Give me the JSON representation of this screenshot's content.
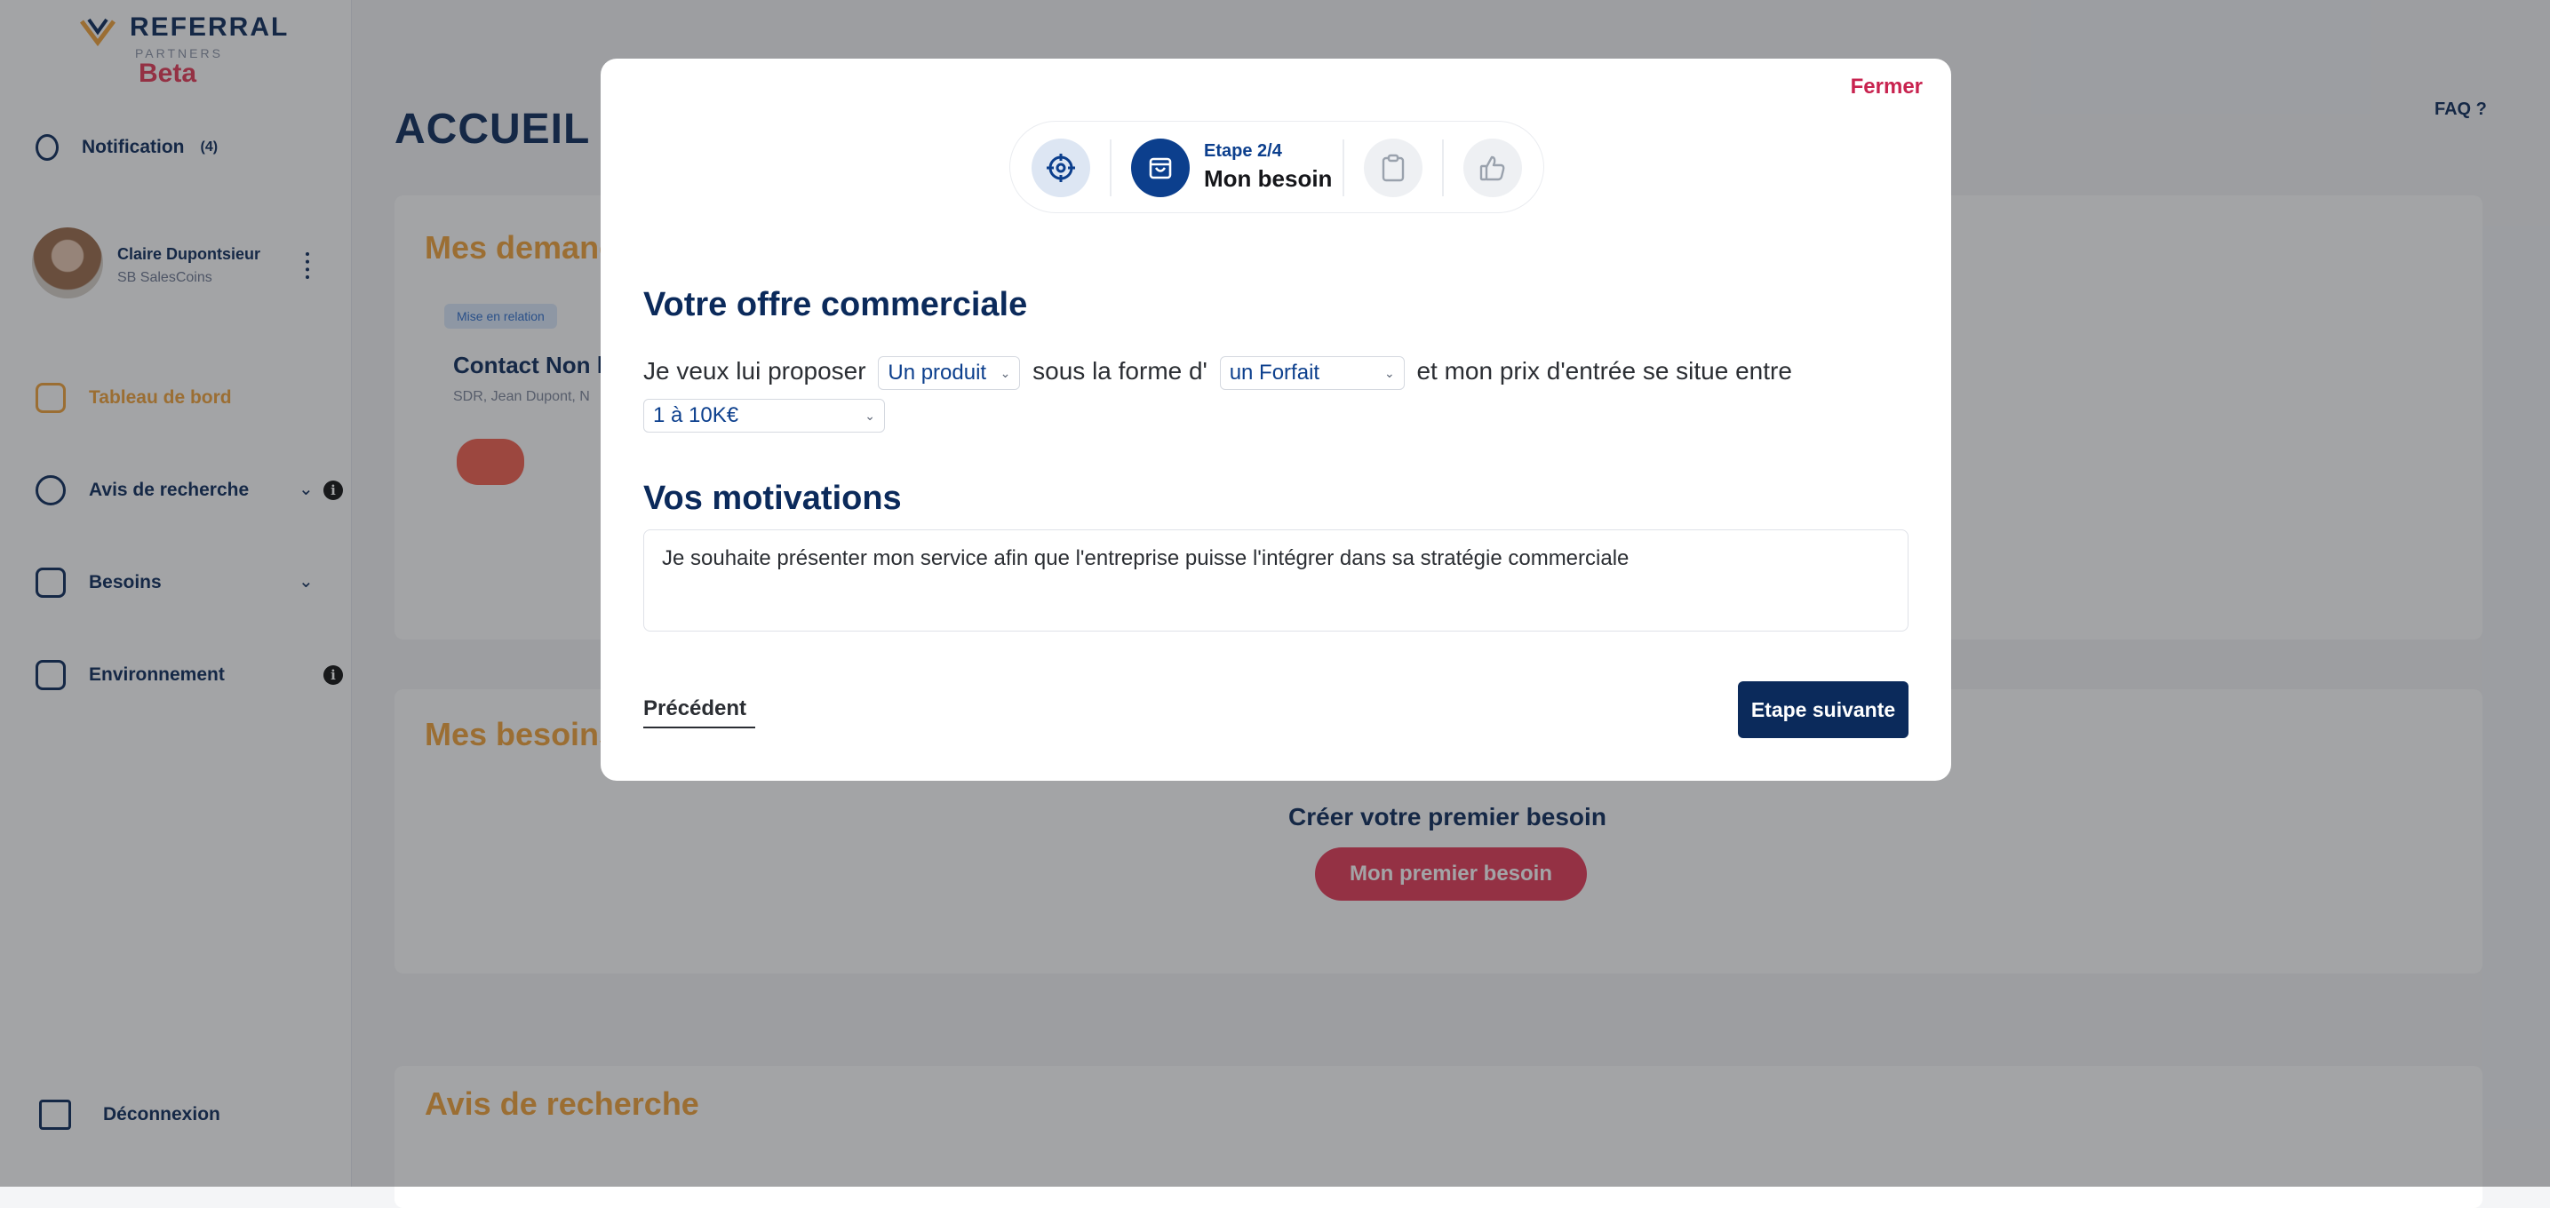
{
  "app": {
    "logo_text": "REFERRAL",
    "logo_sub": "PARTNERS",
    "logo_beta": "Beta",
    "page_title": "ACCUEIL",
    "faq_label": "FAQ ?"
  },
  "sidebar": {
    "notification_label": "Notification",
    "notification_count": "(4)",
    "profile_name": "Claire Dupontsieur",
    "profile_company": "SB SalesCoins",
    "items": [
      {
        "label": "Tableau de bord"
      },
      {
        "label": "Avis de recherche"
      },
      {
        "label": "Besoins"
      },
      {
        "label": "Environnement"
      }
    ],
    "logout_label": "Déconnexion"
  },
  "background": {
    "section1_title": "Mes demandes",
    "chip_label": "Mise en relation",
    "contact_title": "Contact Non li",
    "contact_sub": "SDR, Jean Dupont, N",
    "section2_title": "Mes besoins",
    "create_text": "Créer votre premier besoin",
    "create_button": "Mon premier besoin",
    "section3_title": "Avis de recherche"
  },
  "modal": {
    "close_label": "Fermer",
    "stepper": {
      "current_step": "Etape 2/4",
      "current_name": "Mon besoin",
      "steps": [
        {
          "icon": "target-icon",
          "state": "done"
        },
        {
          "icon": "shopping-bag-icon",
          "state": "current"
        },
        {
          "icon": "clipboard-icon",
          "state": "todo"
        },
        {
          "icon": "thumbs-up-icon",
          "state": "todo"
        }
      ]
    },
    "offer": {
      "heading": "Votre offre commerciale",
      "text1": "Je veux lui proposer",
      "select_product": "Un produit",
      "text2": "sous la forme d'",
      "select_form": "un Forfait",
      "text3": "et mon prix d'entrée se situe entre",
      "select_price": "1 à 10K€"
    },
    "motivations": {
      "heading": "Vos motivations",
      "value": "Je souhaite présenter mon service afin que l'entreprise puisse l'intégrer dans sa stratégie commerciale"
    },
    "previous_label": "Précédent",
    "next_label": "Etape suivante"
  },
  "colors": {
    "primary": "#0b2a5b",
    "accent_red": "#c8234f",
    "accent_orange": "#f2a33a",
    "step_current": "#0c3f8d"
  }
}
